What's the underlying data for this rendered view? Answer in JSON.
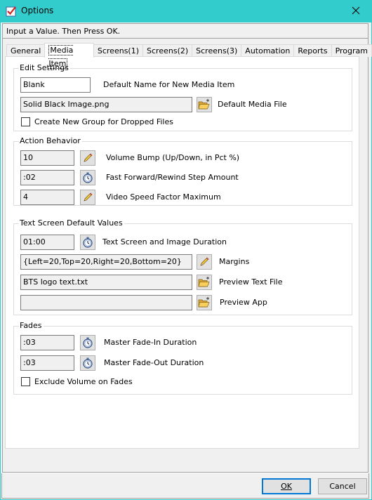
{
  "window": {
    "title": "Options",
    "close_glyph": "✕",
    "accent_color": "#33cccc"
  },
  "hint": "Input a Value. Then Press OK.",
  "tabs": [
    {
      "label": "General",
      "active": false
    },
    {
      "label": "Media Item",
      "active": true
    },
    {
      "label": "Screens(1)",
      "active": false
    },
    {
      "label": "Screens(2)",
      "active": false
    },
    {
      "label": "Screens(3)",
      "active": false
    },
    {
      "label": "Automation",
      "active": false
    },
    {
      "label": "Reports",
      "active": false
    },
    {
      "label": "Program",
      "active": false
    }
  ],
  "edit_settings": {
    "title": "Edit Settings",
    "default_name_value": "Blank",
    "default_name_label": "Default Name for New Media Item",
    "default_media_value": "Solid Black Image.png",
    "default_media_label": "Default Media File",
    "create_group_label": "Create New Group for Dropped Files",
    "create_group_checked": false
  },
  "action_behavior": {
    "title": "Action Behavior",
    "volume_bump_value": "10",
    "volume_bump_label": "Volume Bump (Up/Down, in Pct %)",
    "ff_step_value": ":02",
    "ff_step_label": "Fast Forward/Rewind Step Amount",
    "speed_factor_value": "4",
    "speed_factor_label": "Video Speed Factor Maximum"
  },
  "text_screen": {
    "title": "Text Screen Default Values",
    "duration_value": "01:00",
    "duration_label": "Text Screen and Image Duration",
    "margins_value": "{Left=20,Top=20,Right=20,Bottom=20}",
    "margins_label": "Margins",
    "preview_text_value": "BTS logo text.txt",
    "preview_text_label": "Preview Text File",
    "preview_app_value": "",
    "preview_app_label": "Preview App"
  },
  "fades": {
    "title": "Fades",
    "fade_in_value": ":03",
    "fade_in_label": "Master Fade-In Duration",
    "fade_out_value": ":03",
    "fade_out_label": "Master Fade-Out Duration",
    "exclude_volume_label": "Exclude Volume on Fades",
    "exclude_volume_checked": false
  },
  "buttons": {
    "ok_label": "OK",
    "cancel_label": "Cancel"
  }
}
